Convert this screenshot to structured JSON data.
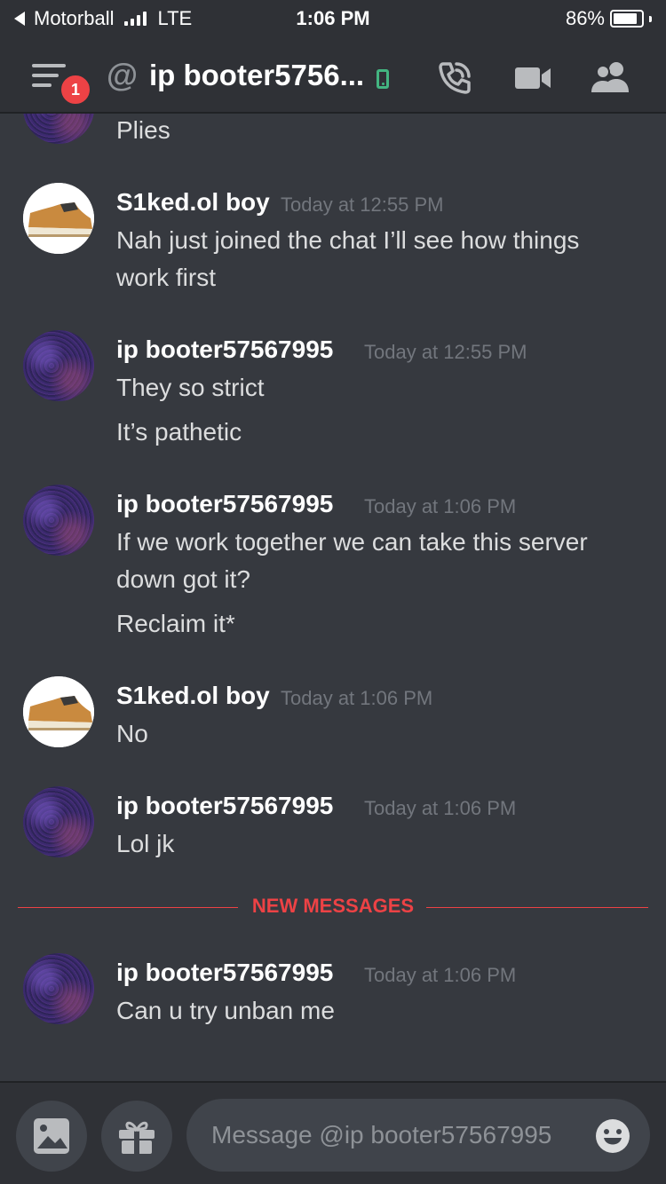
{
  "status_bar": {
    "carrier": "Motorball",
    "network": "LTE",
    "time": "1:06 PM",
    "battery": "86%"
  },
  "header": {
    "unread_badge": "1",
    "at_symbol": "@",
    "title": "ip booter5756...",
    "icons": [
      "menu-icon",
      "mobile-status-icon",
      "call-icon",
      "video-call-icon",
      "members-icon"
    ]
  },
  "messages": [
    {
      "username": "",
      "timestamp": "",
      "lines": [
        "Plies"
      ],
      "avatar": "purple"
    },
    {
      "username": "S1ked.ol boy",
      "timestamp": "Today at 12:55 PM",
      "lines": [
        "Nah just joined the chat I’ll see how things",
        "work first"
      ],
      "avatar": "shoe"
    },
    {
      "username": "ip booter57567995",
      "timestamp": "Today at 12:55 PM",
      "lines": [
        "They so strict",
        "It’s pathetic"
      ],
      "avatar": "purple"
    },
    {
      "username": "ip booter57567995",
      "timestamp": "Today at 1:06 PM",
      "lines": [
        "If we work together we can take this server",
        "down got it?",
        "Reclaim it*"
      ],
      "avatar": "purple"
    },
    {
      "username": "S1ked.ol boy",
      "timestamp": "Today at 1:06 PM",
      "lines": [
        "No"
      ],
      "avatar": "shoe"
    },
    {
      "username": "ip booter57567995",
      "timestamp": "Today at 1:06 PM",
      "lines": [
        "Lol jk"
      ],
      "avatar": "purple"
    },
    {
      "username": "ip booter57567995",
      "timestamp": "Today at 1:06 PM",
      "lines": [
        "Can u try unban me"
      ],
      "avatar": "purple"
    }
  ],
  "divider_label": "NEW MESSAGES",
  "composer": {
    "placeholder": "Message @ip booter57567995",
    "icons": [
      "image-icon",
      "gift-icon",
      "emoji-icon"
    ]
  },
  "colors": {
    "background": "#36393f",
    "header": "#2f3136",
    "accent_red": "#ed4245",
    "online_green": "#43b581"
  }
}
